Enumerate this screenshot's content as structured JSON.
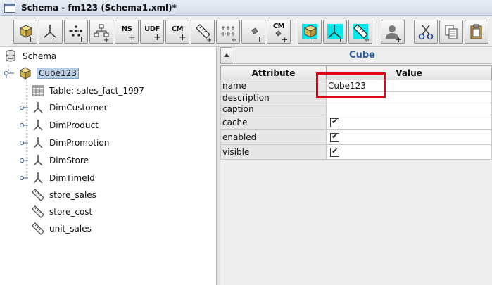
{
  "window": {
    "title": "Schema - fm123 (Schema1.xml)*"
  },
  "toolbar": {
    "buttons": [
      {
        "name": "add-cube-button",
        "label": ""
      },
      {
        "name": "add-dimension-button",
        "label": ""
      },
      {
        "name": "add-hierarchy-button",
        "label": ""
      },
      {
        "name": "add-level-button",
        "label": ""
      },
      {
        "name": "add-named-set-button",
        "label": "NS"
      },
      {
        "name": "add-user-defined-function-button",
        "label": "UDF"
      },
      {
        "name": "add-calculated-member-button",
        "label": "CM"
      },
      {
        "name": "add-measure-button",
        "label": ""
      },
      {
        "name": "add-parameter-button",
        "label": ""
      },
      {
        "name": "add-property-button",
        "label": ""
      },
      {
        "name": "add-cm-property-button",
        "label": "CM"
      },
      {
        "name": "add-virtual-cube-button",
        "label": ""
      },
      {
        "name": "add-virtual-dimension-button",
        "label": ""
      },
      {
        "name": "add-virtual-measure-button",
        "label": ""
      },
      {
        "name": "add-role-button",
        "label": ""
      },
      {
        "name": "cut-button",
        "label": ""
      },
      {
        "name": "copy-button",
        "label": ""
      },
      {
        "name": "paste-button",
        "label": ""
      }
    ]
  },
  "tree": {
    "root": "Schema",
    "cube": "Cube123",
    "table": "Table: sales_fact_1997",
    "dimensions": [
      "DimCustomer",
      "DimProduct",
      "DimPromotion",
      "DimStore",
      "DimTimeId"
    ],
    "measures": [
      "store_sales",
      "store_cost",
      "unit_sales"
    ]
  },
  "properties": {
    "panel_title": "Cube",
    "col_attribute": "Attribute",
    "col_value": "Value",
    "rows": [
      {
        "attribute": "name",
        "value": "Cube123",
        "type": "text"
      },
      {
        "attribute": "description",
        "value": "",
        "type": "text"
      },
      {
        "attribute": "caption",
        "value": "",
        "type": "text"
      },
      {
        "attribute": "cache",
        "value": "true",
        "type": "checkbox"
      },
      {
        "attribute": "enabled",
        "value": "true",
        "type": "checkbox"
      },
      {
        "attribute": "visible",
        "value": "true",
        "type": "checkbox"
      }
    ]
  },
  "colors": {
    "highlight": "#e3000f",
    "panel_title": "#2f5e98",
    "selection": "#b8cfe5"
  }
}
